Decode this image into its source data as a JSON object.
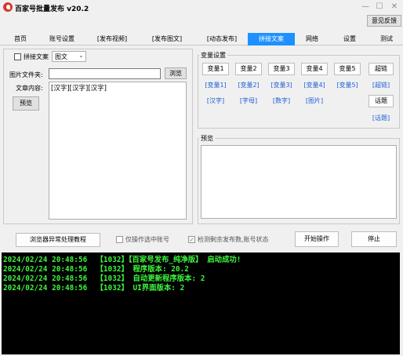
{
  "window": {
    "title": "百家号批量发布   v20.2",
    "feedback_label": "意见反馈",
    "minimize": "—",
    "maximize": "☐",
    "close": "✕"
  },
  "tabs": [
    "首页",
    "账号设置",
    "[发布视频]",
    "[发布图文]",
    "[动态发布]",
    "拼接文案",
    "网络",
    "设置",
    "测试"
  ],
  "active_tab": "拼接文案",
  "left": {
    "splice_label": "拼接文案",
    "type_value": "图文",
    "folder_label": "图片文件夹:",
    "folder_value": "",
    "browse_label": "浏览",
    "content_label": "文章内容:",
    "content_value": "[汉字][汉字][汉字]",
    "preview_label": "预览"
  },
  "variables": {
    "title": "变量设置",
    "buttons": [
      "变量1",
      "变量2",
      "变量3",
      "变量4",
      "变量5"
    ],
    "links_row1": [
      "[变量1]",
      "[变量2]",
      "[变量3]",
      "[变量4]",
      "[变量5]"
    ],
    "links_row2": [
      "[汉字]",
      "[字母]",
      "[数字]",
      "[图片]"
    ],
    "hyperlink_btn": "超链",
    "hyperlink_link": "[超链]",
    "topic_btn": "话题",
    "topic_link": "[话题]"
  },
  "preview_group": {
    "title": "预览",
    "value": ""
  },
  "bottom": {
    "tutorial_label": "浏览器异常处理教程",
    "only_selected_label": "仅操作选中账号",
    "detect_label": "检测剩余发布数,账号状态",
    "start_label": "开始操作",
    "stop_label": "停止"
  },
  "log": [
    "2024/02/24 20:48:56  【1032】【百家号发布_纯净版】 启动成功!",
    "2024/02/24 20:48:56  【1032】 程序版本: 20.2",
    "2024/02/24 20:48:56  【1032】 自动更新程序版本: 2",
    "2024/02/24 20:48:56  【1032】 UI界面版本: 2"
  ]
}
